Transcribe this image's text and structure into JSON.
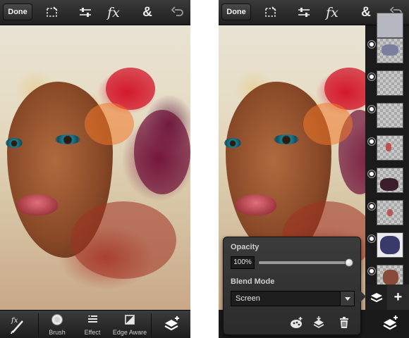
{
  "left_screen": {
    "toolbar": {
      "done_label": "Done",
      "icons": [
        "selection-icon",
        "adjustments-icon",
        "fx-icon",
        "ampersand-icon",
        "undo-icon"
      ],
      "fx_text": "fx",
      "amp_text": "&"
    },
    "bottom_bar": {
      "items": [
        {
          "icon": "fx-brush-icon",
          "label": ""
        },
        {
          "icon": "brush-icon",
          "label": "Brush"
        },
        {
          "icon": "effect-icon",
          "label": "Effect"
        },
        {
          "icon": "edge-aware-icon",
          "label": "Edge Aware"
        },
        {
          "icon": "add-layer-icon",
          "label": ""
        }
      ]
    }
  },
  "right_screen": {
    "toolbar": {
      "done_label": "Done",
      "fx_text": "fx",
      "amp_text": "&"
    },
    "layers": {
      "count": 8,
      "selected_color": "#ffffff"
    },
    "layer_panel_buttons": [
      "layers-icon",
      "add-icon"
    ],
    "add_symbol": "+",
    "popup": {
      "opacity_label": "Opacity",
      "opacity_value": "100%",
      "opacity_fraction": 1.0,
      "blend_mode_label": "Blend Mode",
      "blend_mode_value": "Screen",
      "actions": [
        "add-image-layer-icon",
        "merge-down-icon",
        "trash-icon"
      ]
    }
  },
  "colors": {
    "toolbar": "#2a2a2a",
    "text": "#f2f2f2",
    "popup_bg": "#333333"
  }
}
